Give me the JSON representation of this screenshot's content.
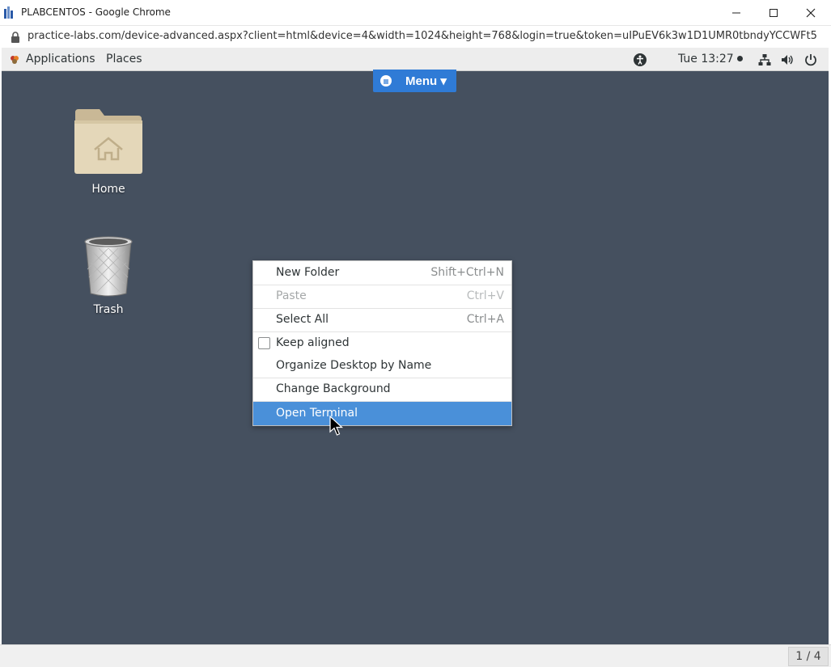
{
  "window": {
    "title": "PLABCENTOS - Google Chrome",
    "url": "practice-labs.com/device-advanced.aspx?client=html&device=4&width=1024&height=768&login=true&token=uIPuEV6k3w1D1UMR0tbndyYCCWFt5fnMq..."
  },
  "panel": {
    "applications_label": "Applications",
    "places_label": "Places",
    "clock": "Tue 13:27"
  },
  "menu_tab": {
    "label": "Menu ▾"
  },
  "desktop": {
    "icons": [
      {
        "label": "Home"
      },
      {
        "label": "Trash"
      }
    ]
  },
  "context_menu": {
    "items": [
      {
        "label": "New Folder",
        "shortcut": "Shift+Ctrl+N"
      },
      {
        "label": "Paste",
        "shortcut": "Ctrl+V",
        "disabled": true
      },
      {
        "label": "Select All",
        "shortcut": "Ctrl+A"
      },
      {
        "label": "Keep aligned",
        "checkbox": true,
        "checked": false
      },
      {
        "label": "Organize Desktop by Name"
      },
      {
        "label": "Change Background"
      },
      {
        "label": "Open Terminal",
        "highlighted": true
      }
    ]
  },
  "statusbar": {
    "page_counter": "1 / 4"
  },
  "colors": {
    "desktop_bg": "#45505f",
    "accent": "#4a90d9",
    "menu_tab": "#2f7bd6"
  }
}
